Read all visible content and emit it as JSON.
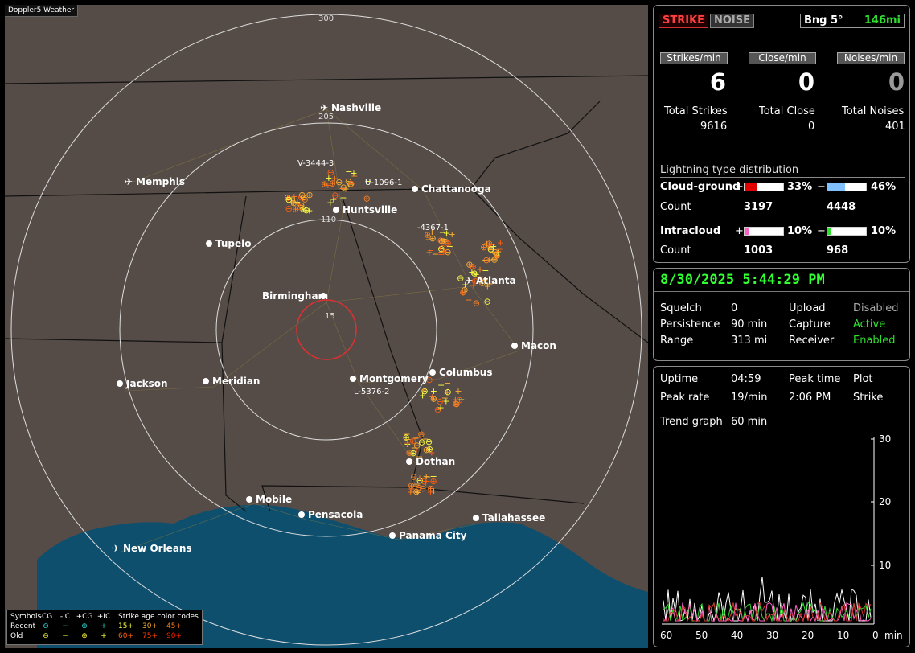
{
  "map": {
    "title": "Doppler5 Weather",
    "ring_labels": [
      "15",
      "110",
      "205",
      "300"
    ],
    "cities": [
      {
        "name": "Nashville",
        "icon": "airport"
      },
      {
        "name": "Memphis",
        "icon": "airport"
      },
      {
        "name": "Chattanooga",
        "icon": "dot"
      },
      {
        "name": "Huntsville",
        "icon": "dot"
      },
      {
        "name": "Tupelo",
        "icon": "dot"
      },
      {
        "name": "Birmingham",
        "icon": "dot"
      },
      {
        "name": "Atlanta",
        "icon": "airport"
      },
      {
        "name": "Macon",
        "icon": "dot"
      },
      {
        "name": "Columbus",
        "icon": "dot"
      },
      {
        "name": "Montgomery",
        "icon": "dot"
      },
      {
        "name": "Jackson",
        "icon": "dot"
      },
      {
        "name": "Meridian",
        "icon": "dot"
      },
      {
        "name": "Dothan",
        "icon": "dot"
      },
      {
        "name": "Mobile",
        "icon": "dot"
      },
      {
        "name": "Pensacola",
        "icon": "dot"
      },
      {
        "name": "Tallahassee",
        "icon": "dot"
      },
      {
        "name": "Panama City",
        "icon": "dot"
      },
      {
        "name": "New Orleans",
        "icon": "airport"
      }
    ],
    "cell_labels": [
      "V-3444-3",
      "U-1096-1",
      "I-4367-1",
      "L-5376-2"
    ]
  },
  "legend": {
    "symbols_label": "Symbols",
    "headers": [
      "-CG",
      "-IC",
      "+CG",
      "+IC"
    ],
    "age_label": "Strike age color codes",
    "recent_label": "Recent",
    "old_label": "Old",
    "recent_ages": [
      "15+",
      "30+",
      "45+"
    ],
    "old_ages": [
      "60+",
      "75+",
      "90+"
    ],
    "age_colors": [
      "#ffff40",
      "#ffb030",
      "#ff8020",
      "#ff6010",
      "#ff4000",
      "#ff2000"
    ]
  },
  "status": {
    "strike_label": "STRIKE",
    "noise_label": "NOISE",
    "bearing": "Bng 5°",
    "distance": "146mi",
    "rates": [
      {
        "header": "Strikes/min",
        "value": "6",
        "total_label": "Total Strikes",
        "total": "9616"
      },
      {
        "header": "Close/min",
        "value": "0",
        "total_label": "Total Close",
        "total": "0"
      },
      {
        "header": "Noises/min",
        "value": "0",
        "total_label": "Total Noises",
        "total": "401"
      }
    ],
    "distribution_title": "Lightning type distribution",
    "cg": {
      "label": "Cloud-ground",
      "pos_sign": "+",
      "pos_pct": "33%",
      "pos_frac": 0.33,
      "neg_sign": "−",
      "neg_pct": "46%",
      "neg_frac": 0.46,
      "count_label": "Count",
      "pos_count": "3197",
      "neg_count": "4448"
    },
    "ic": {
      "label": "Intracloud",
      "pos_sign": "+",
      "pos_pct": "10%",
      "pos_frac": 0.1,
      "neg_sign": "−",
      "neg_pct": "10%",
      "neg_frac": 0.1,
      "count_label": "Count",
      "pos_count": "1003",
      "neg_count": "968"
    }
  },
  "info": {
    "datetime": "8/30/2025 5:44:29 PM",
    "rows": [
      {
        "k1": "Squelch",
        "v1": "0",
        "k2": "Upload",
        "v2": "Disabled"
      },
      {
        "k1": "Persistence",
        "v1": "90 min",
        "k2": "Capture",
        "v2": "Active"
      },
      {
        "k1": "Range",
        "v1": "313 mi",
        "k2": "Receiver",
        "v2": "Enabled"
      }
    ]
  },
  "stats": {
    "uptime_label": "Uptime",
    "uptime": "04:59",
    "peak_time_label": "Peak time",
    "peak_time": "2:06 PM",
    "plot_label": "Plot",
    "plot": "Strike",
    "peak_rate_label": "Peak rate",
    "peak_rate": "19/min",
    "trend_label": "Trend graph",
    "trend": "60 min",
    "y_ticks": [
      "30",
      "20",
      "10"
    ],
    "x_ticks": [
      "60",
      "50",
      "40",
      "30",
      "20",
      "10",
      "0"
    ],
    "x_unit": "min"
  }
}
